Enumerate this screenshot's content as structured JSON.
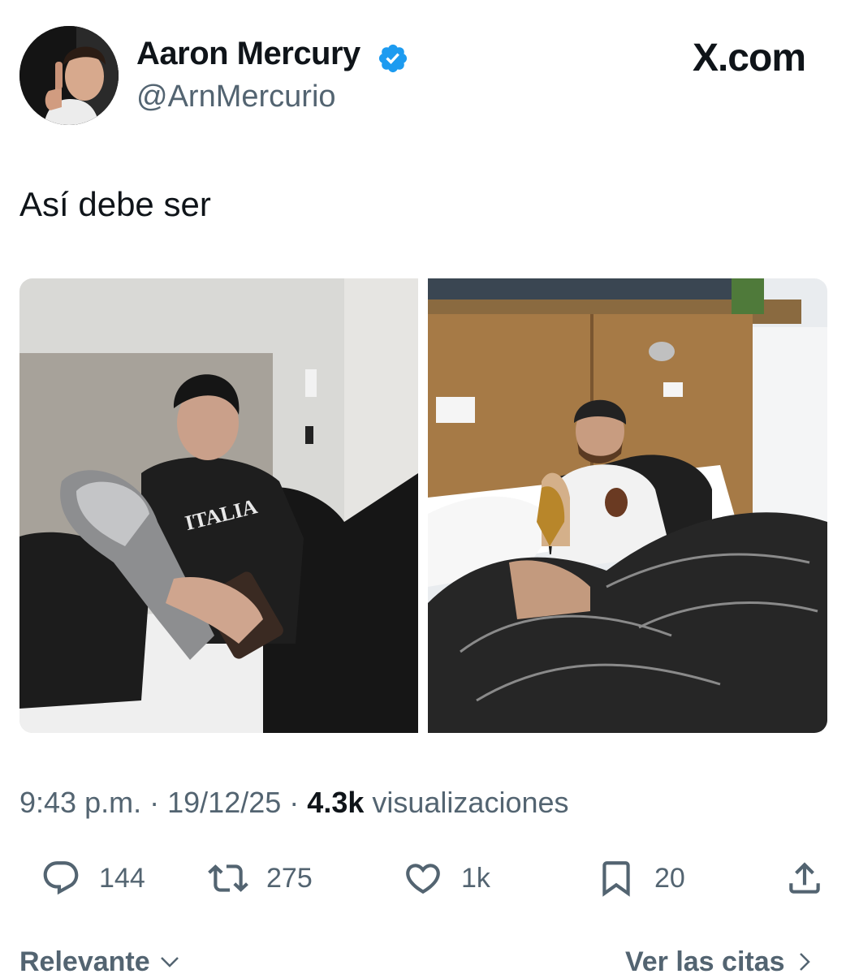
{
  "user": {
    "display_name": "Aaron Mercury",
    "handle": "@ArnMercurio",
    "verified": true,
    "verified_color": "#1d9bf0"
  },
  "brand": {
    "label": "X.com"
  },
  "tweet": {
    "text": "Así debe ser",
    "time": "9:43 p.m.",
    "separator": "·",
    "date": "19/12/25",
    "views_count": "4.3k",
    "views_label": "visualizaciones"
  },
  "actions": {
    "replies": "144",
    "reposts": "275",
    "likes": "1k",
    "bookmarks": "20"
  },
  "footer": {
    "sort_label": "Relevante",
    "quotes_label": "Ver las citas"
  },
  "icons": [
    "verified-badge-icon",
    "reply-icon",
    "repost-icon",
    "like-icon",
    "bookmark-icon",
    "share-icon",
    "chevron-down-icon",
    "chevron-right-icon"
  ],
  "colors": {
    "text": "#0f1419",
    "secondary": "#536471",
    "accent": "#1d9bf0"
  }
}
